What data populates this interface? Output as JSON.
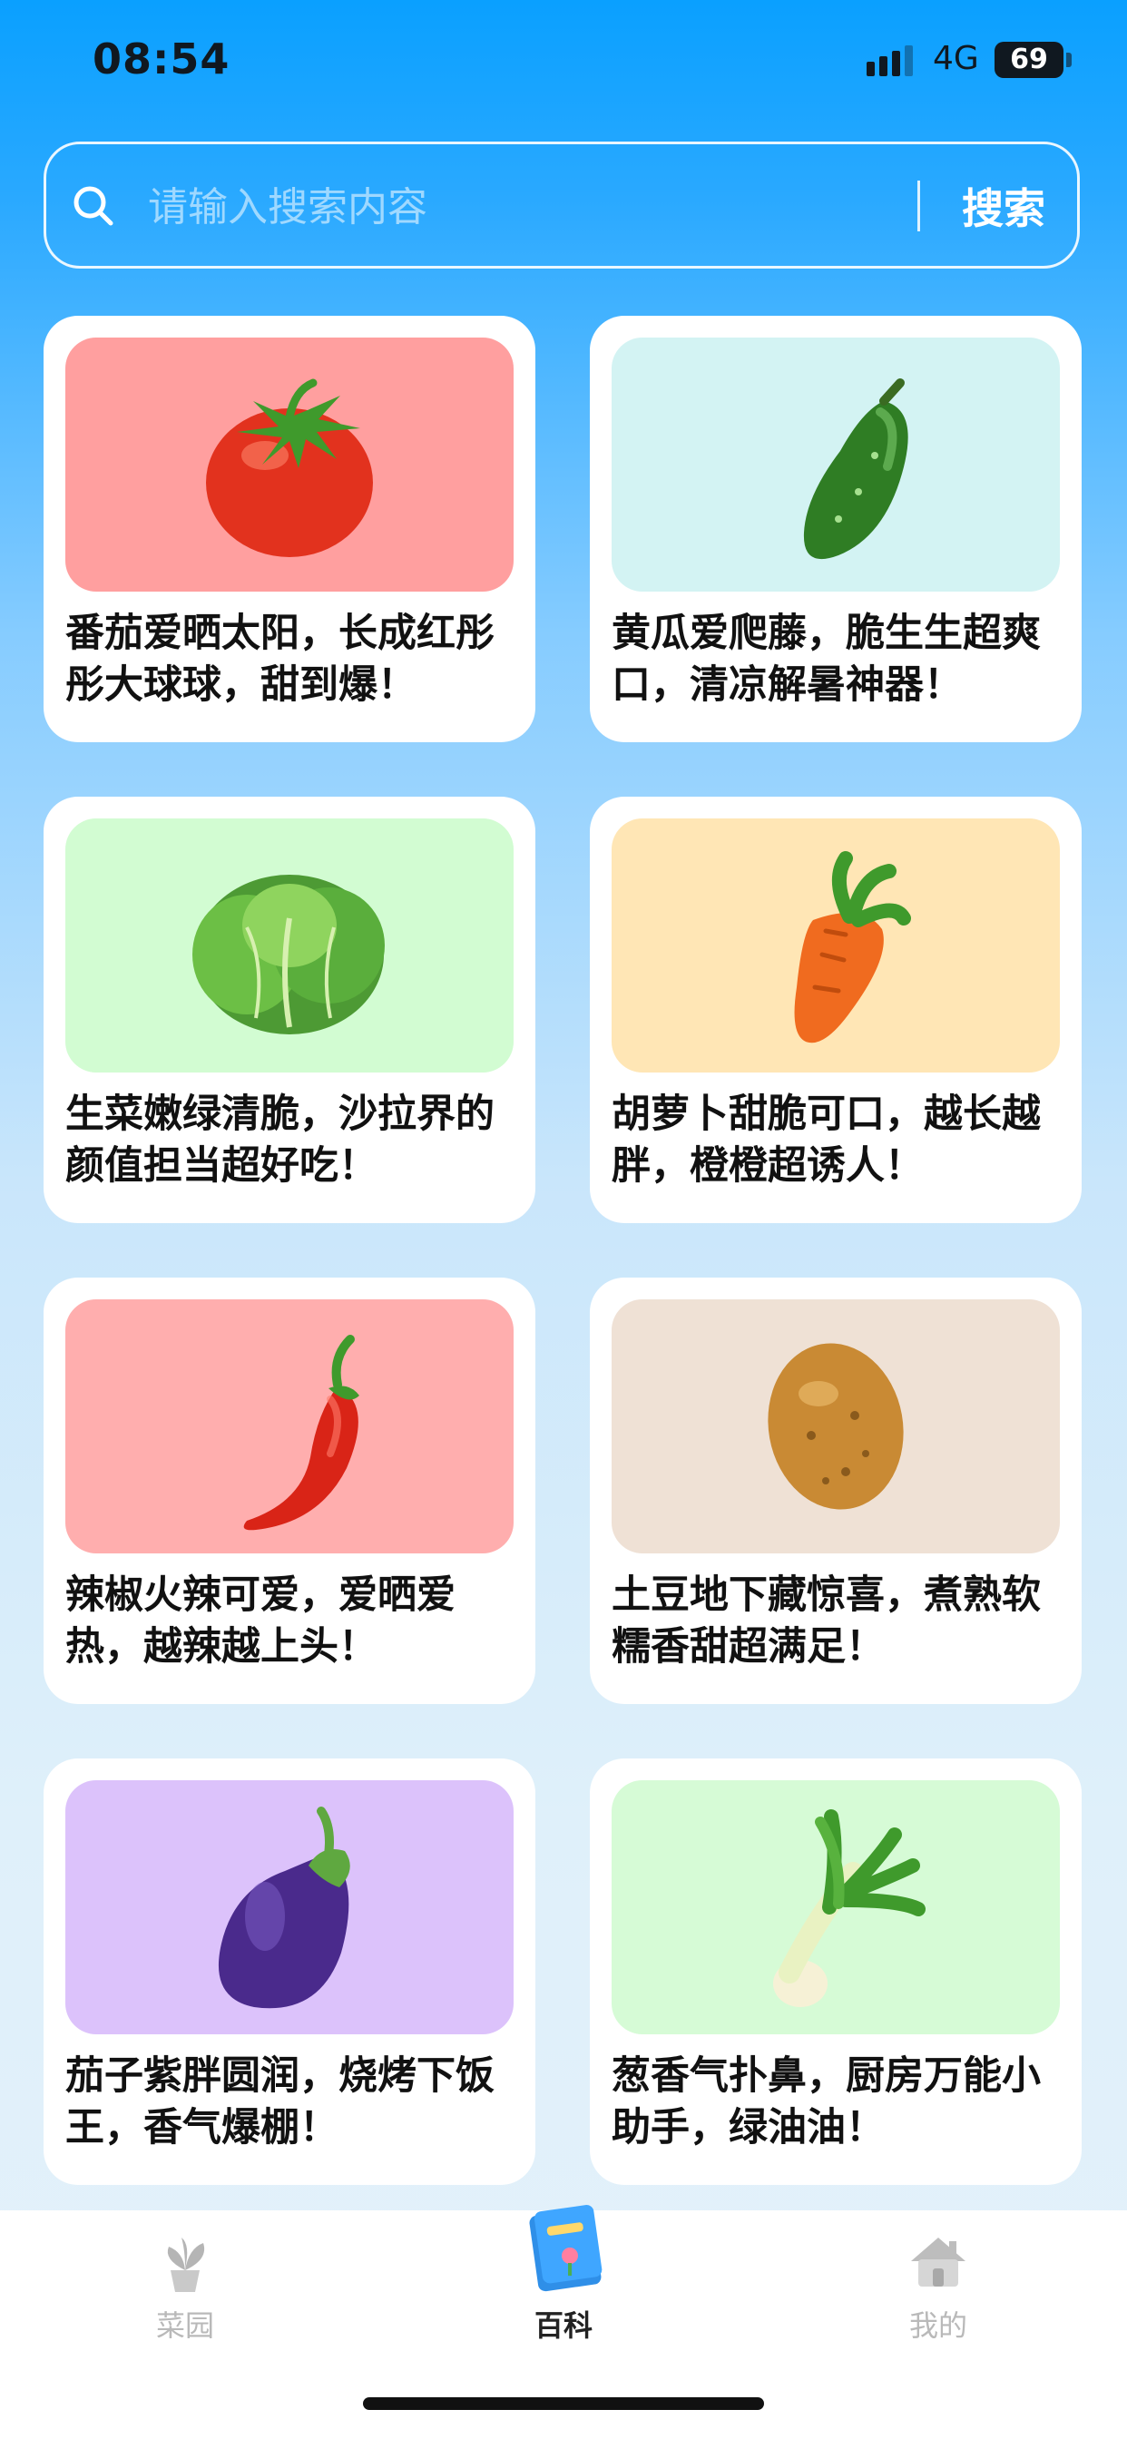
{
  "status_bar": {
    "time": "08:54",
    "network": "4G",
    "battery": "69"
  },
  "search": {
    "placeholder": "请输入搜索内容",
    "value": "",
    "button_label": "搜索"
  },
  "cards": [
    {
      "name": "tomato",
      "bg": "#ff9f9f",
      "text": "番茄爱晒太阳，长成红彤彤大球球，甜到爆！"
    },
    {
      "name": "cucumber",
      "bg": "#d3f3f3",
      "text": "黄瓜爱爬藤，脆生生超爽口，清凉解暑神器！"
    },
    {
      "name": "lettuce",
      "bg": "#d2fcd2",
      "text": "生菜嫩绿清脆，沙拉界的颜值担当超好吃！"
    },
    {
      "name": "carrot",
      "bg": "#ffe6b5",
      "text": "胡萝卜甜脆可口，越长越胖，橙橙超诱人！"
    },
    {
      "name": "chili",
      "bg": "#ffaeae",
      "text": "辣椒火辣可爱，爱晒爱热，越辣越上头！"
    },
    {
      "name": "potato",
      "bg": "#efe1d5",
      "text": "土豆地下藏惊喜，煮熟软糯香甜超满足！"
    },
    {
      "name": "eggplant",
      "bg": "#dcc2fb",
      "text": "茄子紫胖圆润，烧烤下饭王，香气爆棚！"
    },
    {
      "name": "scallion",
      "bg": "#d6fbd6",
      "text": "葱香气扑鼻，厨房万能小助手，绿油油！"
    }
  ],
  "tab_bar": {
    "tabs": [
      {
        "label": "菜园",
        "icon": "plant-pot-icon",
        "active": false
      },
      {
        "label": "百科",
        "icon": "encyclopedia-book-icon",
        "active": true
      },
      {
        "label": "我的",
        "icon": "house-icon",
        "active": false
      }
    ]
  }
}
